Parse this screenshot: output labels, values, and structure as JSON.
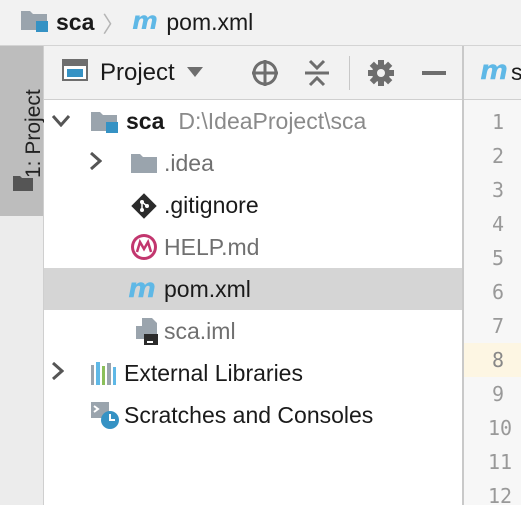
{
  "breadcrumb": {
    "items": [
      {
        "label": "sca",
        "icon": "module-folder-icon"
      },
      {
        "label": "pom.xml",
        "icon": "maven-icon"
      }
    ],
    "separator": "〉"
  },
  "tool_window": {
    "stripe_label": "1: Project",
    "view_selector": "Project",
    "toolbar_icons": [
      "locate-icon",
      "collapse-all-icon",
      "gear-icon",
      "minimize-icon"
    ]
  },
  "tree": {
    "root": {
      "name": "sca",
      "path": "D:\\IdeaProject\\sca"
    },
    "children": [
      {
        "name": ".idea",
        "type": "folder"
      },
      {
        "name": ".gitignore",
        "type": "git"
      },
      {
        "name": "HELP.md",
        "type": "markdown"
      },
      {
        "name": "pom.xml",
        "type": "maven",
        "selected": true
      },
      {
        "name": "sca.iml",
        "type": "iml"
      }
    ],
    "external_libraries": "External Libraries",
    "scratches": "Scratches and Consoles"
  },
  "editor": {
    "tab_label": "s",
    "line_numbers": [
      "1",
      "2",
      "3",
      "4",
      "5",
      "6",
      "7",
      "8",
      "9",
      "10",
      "11",
      "12"
    ],
    "highlighted_line": "8"
  },
  "colors": {
    "maven_blue": "#5fb8e6",
    "module_blue": "#3592c4",
    "selected_row": "#d5d5d5",
    "highlight_line": "#fdf6e3"
  }
}
